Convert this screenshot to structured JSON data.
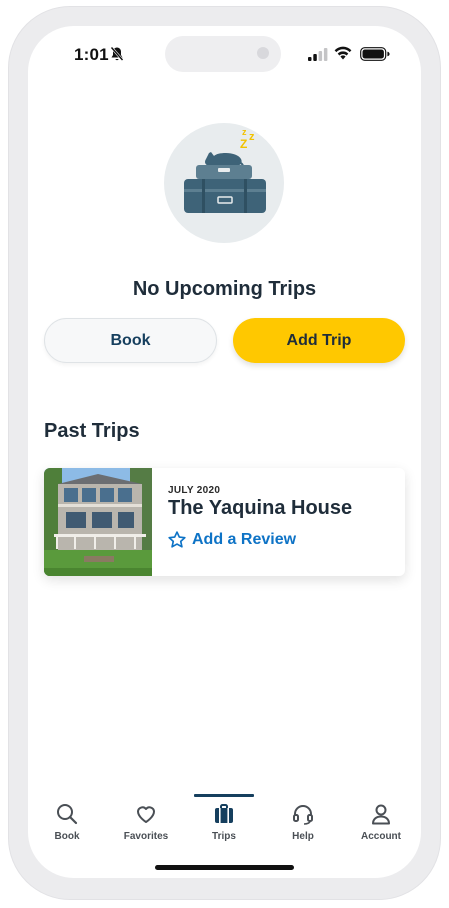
{
  "status_bar": {
    "time": "1:01"
  },
  "empty_state": {
    "title": "No Upcoming Trips"
  },
  "actions": {
    "book_label": "Book",
    "add_trip_label": "Add Trip"
  },
  "past_trips": {
    "section_title": "Past Trips",
    "trips": [
      {
        "date": "JULY 2020",
        "name": "The Yaquina House",
        "review_label": "Add a Review"
      }
    ]
  },
  "tab_bar": {
    "active": "Trips",
    "tabs": [
      {
        "label": "Book",
        "icon": "search-icon"
      },
      {
        "label": "Favorites",
        "icon": "heart-icon"
      },
      {
        "label": "Trips",
        "icon": "suitcase-icon"
      },
      {
        "label": "Help",
        "icon": "headset-icon"
      },
      {
        "label": "Account",
        "icon": "person-icon"
      }
    ]
  },
  "colors": {
    "accent_yellow": "#ffc800",
    "link_blue": "#0e73c6",
    "navy": "#163f5e"
  }
}
